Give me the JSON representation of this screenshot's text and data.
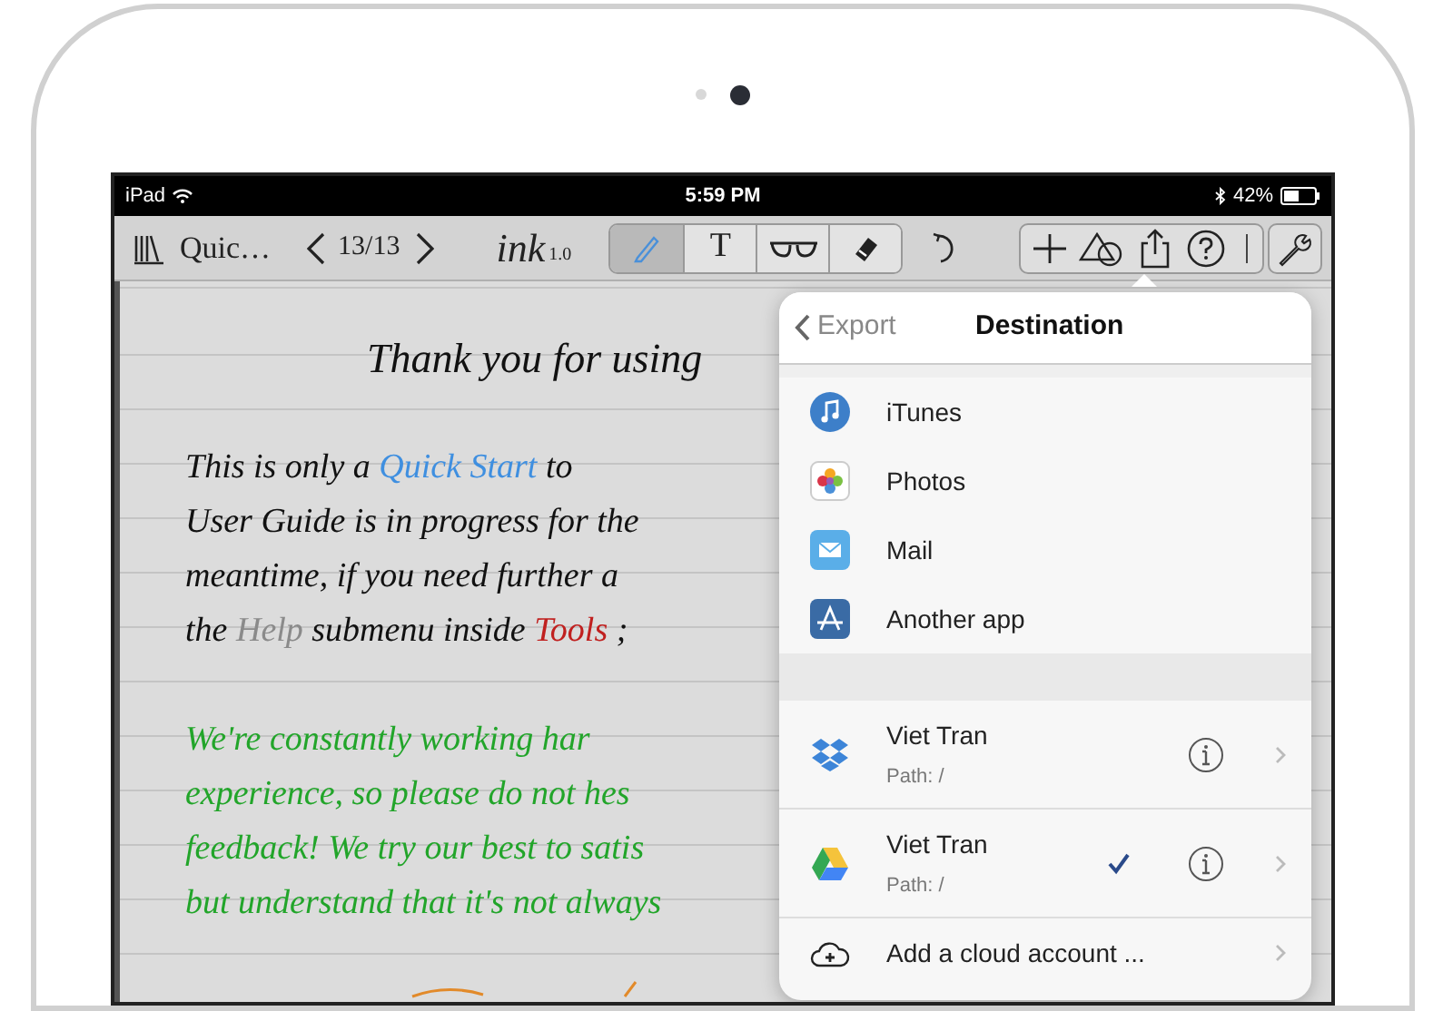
{
  "status_bar": {
    "carrier": "iPad",
    "time": "5:59 PM",
    "battery": "42%"
  },
  "toolbar": {
    "title": "Quic…",
    "page": "13/13",
    "logo": "ink",
    "version": "1.0",
    "tools": [
      {
        "kind": "pen",
        "selected": true
      },
      {
        "kind": "text",
        "label": "T",
        "selected": false
      },
      {
        "kind": "glasses",
        "selected": false
      },
      {
        "kind": "eraser",
        "selected": false
      }
    ],
    "actions": [
      {
        "kind": "line"
      },
      {
        "kind": "shapes"
      },
      {
        "kind": "share"
      },
      {
        "kind": "help"
      }
    ]
  },
  "note": {
    "lines": [
      {
        "kind": "title",
        "segments": [
          {
            "text": "Thank you for using",
            "color": "#111111"
          }
        ]
      },
      {
        "kind": "gap"
      },
      {
        "kind": "text",
        "segments": [
          {
            "text": "This is only a ",
            "color": "#111111"
          },
          {
            "text": "Quick Start",
            "color": "#3f8fe0"
          },
          {
            "text": " to",
            "color": "#111111"
          }
        ]
      },
      {
        "kind": "text",
        "segments": [
          {
            "text": "User Guide is in progress for the",
            "color": "#111111"
          }
        ]
      },
      {
        "kind": "text",
        "segments": [
          {
            "text": "meantime, if you need further a",
            "color": "#111111"
          }
        ]
      },
      {
        "kind": "text",
        "segments": [
          {
            "text": "the ",
            "color": "#111111"
          },
          {
            "text": "Help",
            "color": "#8a8a8a"
          },
          {
            "text": " submenu inside ",
            "color": "#111111"
          },
          {
            "text": "Tools",
            "color": "#c0201f"
          },
          {
            "text": " ;",
            "color": "#111111"
          }
        ]
      },
      {
        "kind": "gap"
      },
      {
        "kind": "text",
        "segments": [
          {
            "text": "We're constantly working har",
            "color": "#22a52a"
          }
        ]
      },
      {
        "kind": "text",
        "segments": [
          {
            "text": "experience, so please do not hes",
            "color": "#22a52a"
          }
        ]
      },
      {
        "kind": "text",
        "segments": [
          {
            "text": "feedback! We try our best to satis",
            "color": "#22a52a"
          }
        ]
      },
      {
        "kind": "text",
        "segments": [
          {
            "text": "but understand that it's not always",
            "color": "#22a52a"
          }
        ]
      }
    ]
  },
  "popover": {
    "back": "Export",
    "title": "Destination",
    "apps": [
      {
        "kind": "itunes",
        "label": "iTunes"
      },
      {
        "kind": "photos",
        "label": "Photos"
      },
      {
        "kind": "mail",
        "label": "Mail"
      },
      {
        "kind": "appstore",
        "label": "Another app"
      }
    ],
    "accounts": [
      {
        "kind": "dropbox",
        "name": "Viet Tran",
        "path": "Path: /",
        "selected": false
      },
      {
        "kind": "gdrive",
        "name": "Viet Tran",
        "path": "Path: /",
        "selected": true
      }
    ],
    "add": "Add a cloud account ..."
  }
}
